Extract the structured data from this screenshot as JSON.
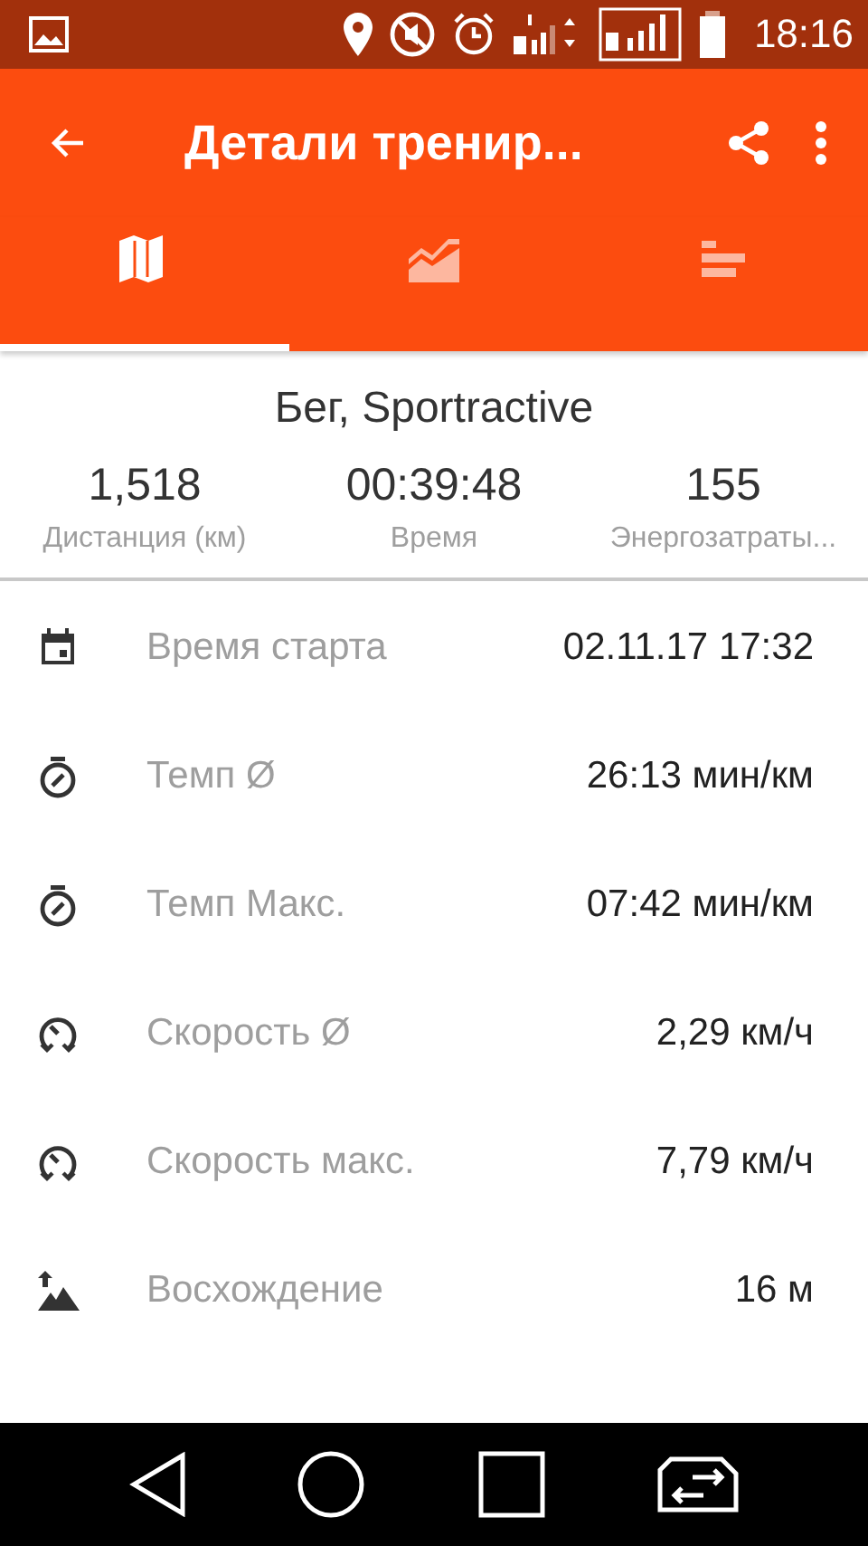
{
  "status_bar": {
    "time": "18:16"
  },
  "toolbar": {
    "title": "Детали тренир..."
  },
  "tabs": [
    {
      "selected": true
    },
    {
      "selected": false
    },
    {
      "selected": false
    }
  ],
  "summary": {
    "title": "Бег, Sportractive",
    "stats": [
      {
        "value": "1,518",
        "label": "Дистанция (км)"
      },
      {
        "value": "00:39:48",
        "label": "Время"
      },
      {
        "value": "155",
        "label": "Энергозатраты..."
      }
    ]
  },
  "details": [
    {
      "label": "Время старта",
      "value": "02.11.17 17:32"
    },
    {
      "label": "Темп Ø",
      "value": "26:13 мин/км"
    },
    {
      "label": "Темп Макс.",
      "value": "07:42 мин/км"
    },
    {
      "label": "Скорость Ø",
      "value": "2,29 км/ч"
    },
    {
      "label": "Скорость макс.",
      "value": "7,79 км/ч"
    },
    {
      "label": "Восхождение",
      "value": "16 м"
    }
  ]
}
